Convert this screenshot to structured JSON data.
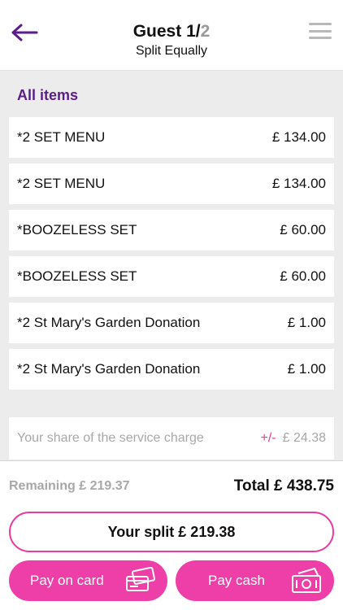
{
  "header": {
    "title_main": "Guest 1/",
    "title_of": "2",
    "subtitle": "Split Equally",
    "back_icon": "arrow-left-icon",
    "menu_icon": "hamburger-icon",
    "accent": "#5a1d8c"
  },
  "section": {
    "label": "All items"
  },
  "items": [
    {
      "name": "*2 SET MENU",
      "price": "£ 134.00"
    },
    {
      "name": "*2 SET MENU",
      "price": "£ 134.00"
    },
    {
      "name": "*BOOZELESS SET",
      "price": "£ 60.00"
    },
    {
      "name": "*BOOZELESS SET",
      "price": "£ 60.00"
    },
    {
      "name": "*2 St Mary's Garden Donation",
      "price": "£ 1.00"
    },
    {
      "name": "*2 St Mary's Garden Donation",
      "price": "£ 1.00"
    }
  ],
  "service": {
    "label": "Your share of the service charge",
    "adjust": "+/-",
    "amount": "£ 24.38"
  },
  "summary": {
    "remaining": "Remaining  £ 219.37",
    "total": "Total  £ 438.75"
  },
  "actions": {
    "split_label": "Your split  £ 219.38",
    "card_label": "Pay on card",
    "cash_label": "Pay cash",
    "card_icon": "credit-card-icon",
    "cash_icon": "banknote-icon",
    "brand_pink": "#ee3fa9"
  }
}
